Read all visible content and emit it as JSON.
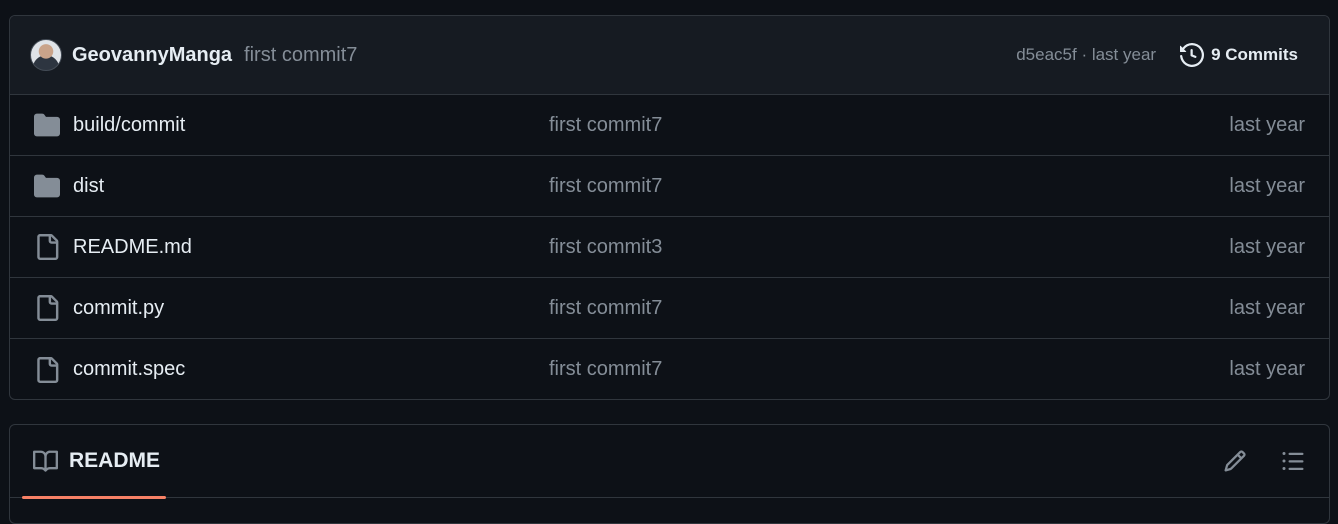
{
  "latest_commit": {
    "author": "GeovannyManga",
    "message": "first commit7",
    "sha": "d5eac5f",
    "separator": " · ",
    "time": "last year",
    "commits_count_label": "9 Commits"
  },
  "files": [
    {
      "name": "build/commit",
      "type": "folder",
      "commit": "first commit7",
      "time": "last year"
    },
    {
      "name": "dist",
      "type": "folder",
      "commit": "first commit7",
      "time": "last year"
    },
    {
      "name": "README.md",
      "type": "file",
      "commit": "first commit3",
      "time": "last year"
    },
    {
      "name": "commit.py",
      "type": "file",
      "commit": "first commit7",
      "time": "last year"
    },
    {
      "name": "commit.spec",
      "type": "file",
      "commit": "first commit7",
      "time": "last year"
    }
  ],
  "readme": {
    "tab_label": "README"
  },
  "icons": {
    "folder": "folder-icon",
    "file": "file-icon",
    "history": "history-icon",
    "book": "book-icon",
    "pencil": "pencil-icon",
    "list": "list-unordered-icon"
  },
  "colors": {
    "background": "#0d1117",
    "header_bg": "#161b22",
    "border": "#30363d",
    "muted_text": "#848d97",
    "text": "#e6edf3",
    "accent_underline": "#f78166"
  }
}
